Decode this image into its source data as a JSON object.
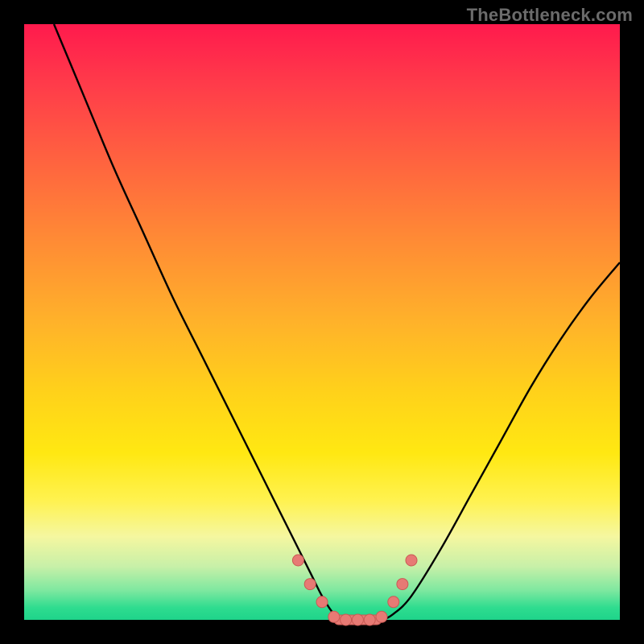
{
  "watermark": "TheBottleneck.com",
  "colors": {
    "frame": "#000000",
    "curve_stroke": "#000000",
    "marker_fill": "#e77a74",
    "marker_stroke": "#c95a54",
    "gradient_stops": [
      "#ff1a4d",
      "#ff3b4a",
      "#ff6040",
      "#ff8a35",
      "#ffb22a",
      "#ffd21a",
      "#ffe812",
      "#fff250",
      "#f5f7a0",
      "#c8f0a8",
      "#7fe8a0",
      "#2edc8f",
      "#1fd48a"
    ]
  },
  "chart_data": {
    "type": "line",
    "title": "",
    "xlabel": "",
    "ylabel": "",
    "xlim": [
      0,
      100
    ],
    "ylim": [
      0,
      100
    ],
    "note": "Axes are normalized 0–100 (no tick labels shown in image). Y encodes bottleneck percentage where 0 = no bottleneck (bottom/green) and 100 = full bottleneck (top/red). The curve sweeps from top-left down to a flat minimum near x≈50–60 then rises toward the right.",
    "series": [
      {
        "name": "bottleneck-curve",
        "x": [
          5,
          10,
          15,
          20,
          25,
          30,
          35,
          40,
          45,
          48,
          50,
          52,
          54,
          56,
          58,
          60,
          62,
          65,
          70,
          75,
          80,
          85,
          90,
          95,
          100
        ],
        "y": [
          100,
          88,
          76,
          65,
          54,
          44,
          34,
          24,
          14,
          8,
          4,
          1,
          0,
          0,
          0,
          0,
          1,
          4,
          12,
          21,
          30,
          39,
          47,
          54,
          60
        ]
      }
    ],
    "markers": {
      "name": "highlighted-points",
      "note": "Salmon-colored dots and a short flat segment near the curve minimum.",
      "points": [
        {
          "x": 46,
          "y": 10
        },
        {
          "x": 48,
          "y": 6
        },
        {
          "x": 50,
          "y": 3
        },
        {
          "x": 52,
          "y": 0.5
        },
        {
          "x": 54,
          "y": 0
        },
        {
          "x": 56,
          "y": 0
        },
        {
          "x": 58,
          "y": 0
        },
        {
          "x": 60,
          "y": 0.5
        },
        {
          "x": 62,
          "y": 3
        },
        {
          "x": 63.5,
          "y": 6
        },
        {
          "x": 65,
          "y": 10
        }
      ],
      "flat_segment": {
        "x0": 52,
        "x1": 60,
        "y": 0
      }
    }
  }
}
